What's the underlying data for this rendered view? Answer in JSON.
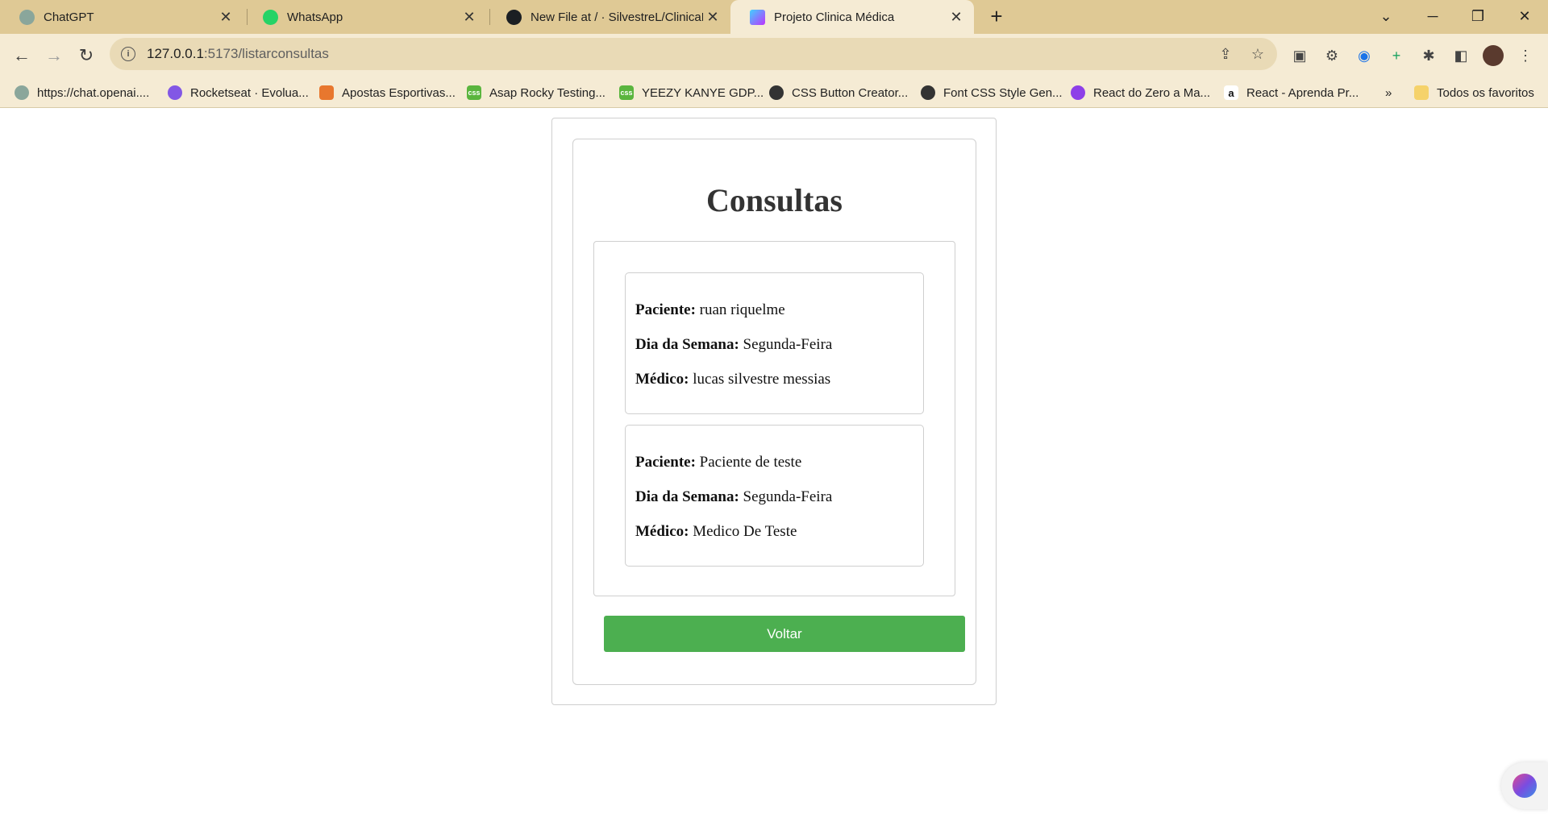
{
  "browser": {
    "tabs": [
      {
        "title": "ChatGPT",
        "icon": "chatgpt-icon",
        "active": false
      },
      {
        "title": "WhatsApp",
        "icon": "whatsapp-icon",
        "active": false
      },
      {
        "title": "New File at / · SilvestreL/ClinicaM",
        "icon": "github-icon",
        "active": false
      },
      {
        "title": "Projeto Clinica Médica",
        "icon": "vite-icon",
        "active": true
      }
    ],
    "address": {
      "host": "127.0.0.1",
      "path": ":5173/listarconsultas"
    },
    "bookmarks": [
      {
        "label": "https://chat.openai....",
        "icon": "chatgpt-icon",
        "color": "#8aa69b"
      },
      {
        "label": "Rocketseat · Evolua...",
        "icon": "rocketseat-icon",
        "color": "#8257e5"
      },
      {
        "label": "Apostas Esportivas...",
        "icon": "betting-icon",
        "color": "#e8772e"
      },
      {
        "label": "Asap Rocky Testing...",
        "icon": "css-icon",
        "color": "#5ab53e"
      },
      {
        "label": "YEEZY KANYE GDP...",
        "icon": "css-icon",
        "color": "#5ab53e"
      },
      {
        "label": "CSS Button Creator...",
        "icon": "globe-icon",
        "color": "#333333"
      },
      {
        "label": "Font CSS Style Gen...",
        "icon": "globe-icon",
        "color": "#333333"
      },
      {
        "label": "React do Zero a Ma...",
        "icon": "hotmart-icon",
        "color": "#8d3fe8"
      },
      {
        "label": "React - Aprenda Pr...",
        "icon": "amazon-icon",
        "color": "#111111"
      }
    ],
    "bookmarks_overflow": "»",
    "all_bookmarks": "Todos os favoritos"
  },
  "page": {
    "title": "Consultas",
    "labels": {
      "paciente": "Paciente:",
      "dia": "Dia da Semana:",
      "medico": "Médico:"
    },
    "consultas": [
      {
        "paciente": "ruan riquelme",
        "dia": "Segunda-Feira",
        "medico": "lucas silvestre messias"
      },
      {
        "paciente": "Paciente de teste",
        "dia": "Segunda-Feira",
        "medico": "Medico De Teste"
      }
    ],
    "back_button": "Voltar"
  },
  "colors": {
    "tabstrip": "#dfc995",
    "toolbar": "#f5ebd4",
    "button_green": "#4caf50"
  }
}
